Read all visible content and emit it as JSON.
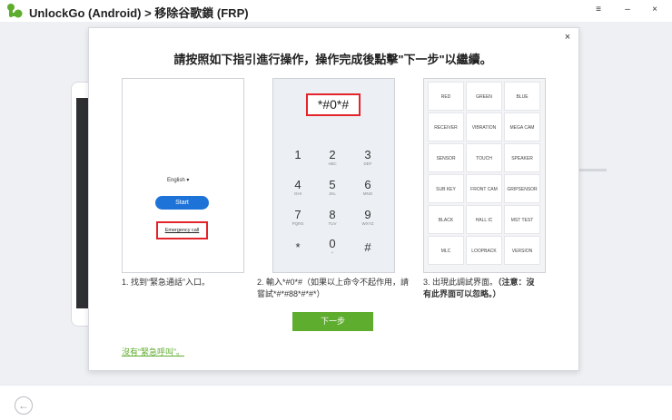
{
  "window": {
    "app_title": "UnlockGo (Android) > 移除谷歌鎖 (FRP)",
    "menu_label": "≡",
    "minimize_label": "–",
    "close_label": "×"
  },
  "modal": {
    "close_label": "×",
    "heading": "請按照如下指引進行操作，操作完成後點擊\"下一步\"以繼續。",
    "step1": {
      "language": "English ▾",
      "start_button": "Start",
      "emergency_call": "Emergency call",
      "caption": "1. 找到“緊急通話”入口。"
    },
    "step2": {
      "code": "*#0*#",
      "keys": [
        {
          "num": "1",
          "sub": ""
        },
        {
          "num": "2",
          "sub": "ABC"
        },
        {
          "num": "3",
          "sub": "DEF"
        },
        {
          "num": "4",
          "sub": "GHI"
        },
        {
          "num": "5",
          "sub": "JKL"
        },
        {
          "num": "6",
          "sub": "MNO"
        },
        {
          "num": "7",
          "sub": "PQRS"
        },
        {
          "num": "8",
          "sub": "TUV"
        },
        {
          "num": "9",
          "sub": "WXYZ"
        },
        {
          "num": "*",
          "sub": ""
        },
        {
          "num": "0",
          "sub": "+"
        },
        {
          "num": "#",
          "sub": ""
        }
      ],
      "caption_line1": "2. 輸入*#0*#（如果以上命令不起作用，請",
      "caption_line2": "嘗試*#*#88*#*#*）"
    },
    "step3": {
      "cells": [
        "RED",
        "GREEN",
        "BLUE",
        "RECEIVER",
        "VIBRATION",
        "MEGA CAM",
        "SENSOR",
        "TOUCH",
        "SPEAKER",
        "SUB KEY",
        "FRONT CAM",
        "GRIPSENSOR",
        "BLACK",
        "HALL IC",
        "MST TEST",
        "MLC",
        "LOOPBACK",
        "VERSION"
      ],
      "caption_line1_normal": "3. 出現此調試界面。",
      "caption_line1_bold": "（注意：沒",
      "caption_line2_bold": "有此界面可以忽略。）"
    },
    "next_button": "下一步",
    "no_emergency_link": "沒有“緊急呼叫”。"
  },
  "footer": {
    "back_icon": "←"
  },
  "colors": {
    "accent_green": "#5fad2f",
    "highlight_red": "#e3242b",
    "start_blue": "#1d73d8"
  }
}
